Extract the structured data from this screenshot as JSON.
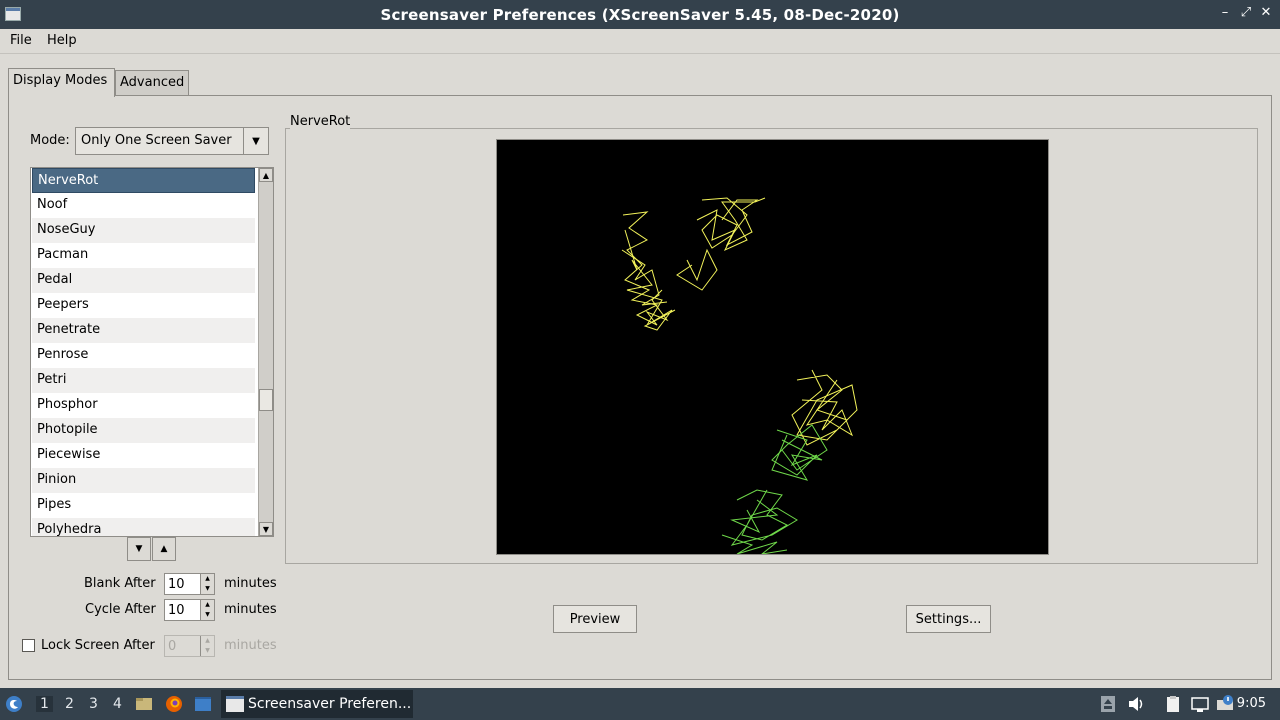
{
  "window": {
    "title": "Screensaver Preferences  (XScreenSaver 5.45, 08-Dec-2020)",
    "controls": [
      "–",
      "⤢",
      "✕"
    ]
  },
  "menu": {
    "file": "File",
    "help": "Help"
  },
  "tabs": {
    "display_modes": "Display Modes",
    "advanced": "Advanced"
  },
  "mode": {
    "label": "Mode:",
    "value": "Only One Screen Saver"
  },
  "savers": {
    "selected": "NerveRot",
    "items": [
      "NerveRot",
      "Noof",
      "NoseGuy",
      "Pacman",
      "Pedal",
      "Peepers",
      "Penetrate",
      "Penrose",
      "Petri",
      "Phosphor",
      "Photopile",
      "Piecewise",
      "Pinion",
      "Pipes",
      "Polyhedra"
    ]
  },
  "timing": {
    "blank_after_label": "Blank After",
    "blank_after_value": "10",
    "cycle_after_label": "Cycle After",
    "cycle_after_value": "10",
    "lock_label": "Lock Screen After",
    "lock_value": "0",
    "units": "minutes"
  },
  "preview": {
    "frame_label": "NerveRot",
    "preview_button": "Preview",
    "settings_button": "Settings...",
    "colors": {
      "background": "#000000",
      "yellow": "#f2f25a",
      "green": "#6fd84a"
    }
  },
  "taskbar": {
    "workspaces": [
      "1",
      "2",
      "3",
      "4"
    ],
    "active_workspace": "1",
    "task_title": "Screensaver Preferen...",
    "clock": "9:05"
  }
}
